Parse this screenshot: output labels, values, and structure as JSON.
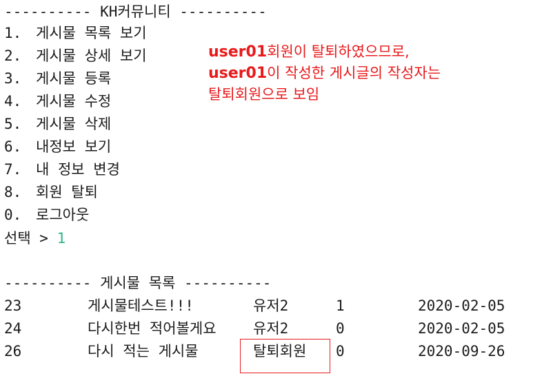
{
  "header": {
    "title": "---------- KH커뮤니티 ----------"
  },
  "menu": {
    "items": [
      {
        "num": "1.",
        "label": "게시물 목록 보기"
      },
      {
        "num": "2.",
        "label": "게시물 상세 보기"
      },
      {
        "num": "3.",
        "label": "게시물 등록"
      },
      {
        "num": "4.",
        "label": "게시물 수정"
      },
      {
        "num": "5.",
        "label": "게시물 삭제"
      },
      {
        "num": "6.",
        "label": "내정보 보기"
      },
      {
        "num": "7.",
        "label": "내 정보 변경"
      },
      {
        "num": "8.",
        "label": "회원 탈퇴"
      },
      {
        "num": "0.",
        "label": "로그아웃"
      }
    ],
    "prompt": "선택 > ",
    "input": "1"
  },
  "annotation": {
    "line1_uid": "user01",
    "line1_text": "회원이 탈퇴하였으므로,",
    "line2_uid": "user01",
    "line2_text": "이 작성한 게시글의 작성자는",
    "line3_text": "탈퇴회원으로 보임",
    "color": "#e8191b"
  },
  "board": {
    "title": "---------- 게시물 목록 ----------",
    "rows": [
      {
        "no": "23",
        "title": "게시물테스트!!!",
        "writer": "유저2",
        "count": "1",
        "date": "2020-02-05"
      },
      {
        "no": "24",
        "title": "다시한번 적어볼게요",
        "writer": "유저2",
        "count": "0",
        "date": "2020-02-05"
      },
      {
        "no": "26",
        "title": "다시 적는 게시물",
        "writer": "탈퇴회원",
        "count": "0",
        "date": "2020-09-26"
      }
    ]
  },
  "colors": {
    "text": "#1a1a1a",
    "input_accent": "#2fb38a",
    "annotation_red": "#e8191b",
    "background": "#ffffff"
  }
}
